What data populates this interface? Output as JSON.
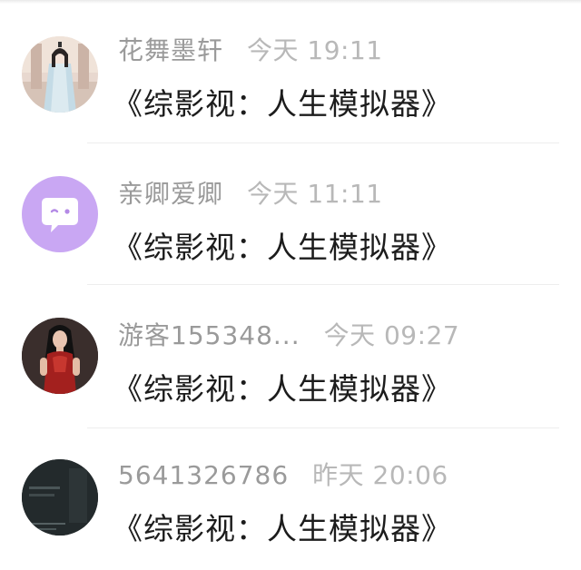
{
  "messages": [
    {
      "name": "花舞墨轩",
      "time": "今天 19:11",
      "text": "《综影视：人生模拟器》",
      "avatar_icon": "anime-character-avatar"
    },
    {
      "name": "亲卿爱卿",
      "time": "今天 11:11",
      "text": "《综影视：人生模拟器》",
      "avatar_icon": "chat-bubble-avatar",
      "avatar_color": "#c9a7f3"
    },
    {
      "name": "游客155348...",
      "time": "今天 09:27",
      "text": "《综影视：人生模拟器》",
      "avatar_icon": "woman-red-dress-avatar"
    },
    {
      "name": "5641326786",
      "time": "昨天 20:06",
      "text": "《综影视：人生模拟器》",
      "avatar_icon": "dark-photo-avatar"
    }
  ],
  "colors": {
    "name": "#9a9a9a",
    "time": "#b8b8b8",
    "message": "#1c1c1c",
    "divider": "#ededed"
  }
}
